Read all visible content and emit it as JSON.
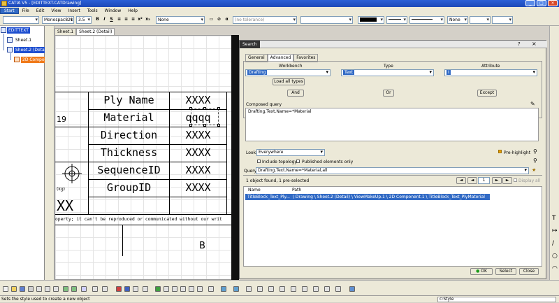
{
  "window": {
    "title": "CATIA V5 - [EDITTEXT.CATDrawing]"
  },
  "menu": [
    "Start",
    "File",
    "Edit",
    "View",
    "Insert",
    "Tools",
    "Window",
    "Help"
  ],
  "toolbar": {
    "font_name": "Monospac821",
    "font_size": "3.5",
    "bold": "B",
    "italic": "I",
    "underline": "S",
    "anchor": "None",
    "tolerance": "(no tolerance)",
    "line_end": "None"
  },
  "tree": {
    "root": "EDITTEXT",
    "sheet1": "Sheet.1",
    "sheet2": "Sheet.2 (Detail)",
    "component": "2D Component.1"
  },
  "tabs": [
    "Sheet.1",
    "Sheet.2 (Detail)"
  ],
  "drawing": {
    "rows": [
      "Ply Name",
      "Material",
      "Direction",
      "Thickness",
      "SequenceID",
      "GroupID"
    ],
    "values": [
      "XXXX",
      "qqqq",
      "XXXX",
      "XXXX",
      "XXXX",
      "XXXX"
    ],
    "left_number": "19",
    "kg_label": "(kg)",
    "xx_label": "XX",
    "footer_text": "operty; it can't be reproduced or communicated without our writ",
    "b_label": "B"
  },
  "search_dialog": {
    "title": "Search",
    "tabs": [
      "General",
      "Advanced",
      "Favorites"
    ],
    "headers": {
      "workbench": "Workbench",
      "type": "Type",
      "attribute": "Attribute"
    },
    "workbench_value": "Drafting",
    "type_value": "Text",
    "attribute_value": "I",
    "load_all_types": "Load all types",
    "and_btn": "And",
    "or_btn": "Or",
    "except_btn": "Except",
    "composed_query_label": "Composed query",
    "composed_query_value": "Drafting.Text.Name=*Material",
    "look_label": "Look:",
    "look_value": "Everywhere",
    "prehighlight": "Pre-highlight",
    "include_topology": "Include topology",
    "published_only": "Published elements only",
    "query_label": "Query:",
    "query_value": "Drafting.Text.Name=*Material,all",
    "result_summary": "1 object found, 1 pre-selected",
    "page_number": "1",
    "display_all": "Display all",
    "col_name": "Name",
    "col_path": "Path",
    "result_name": "TitleBlock_Text_Ply...",
    "result_path": "\\ Drawing \\ Sheet.2 (Detail) \\ ViewMakeUp.1 \\ 2D Component.1 \\ TitleBlock_Text_PlyMaterial",
    "ok_btn": "OK",
    "select_btn": "Select",
    "close_btn": "Close"
  },
  "status": {
    "message": "Sets the style used to create a new object",
    "command": "c:Style"
  }
}
